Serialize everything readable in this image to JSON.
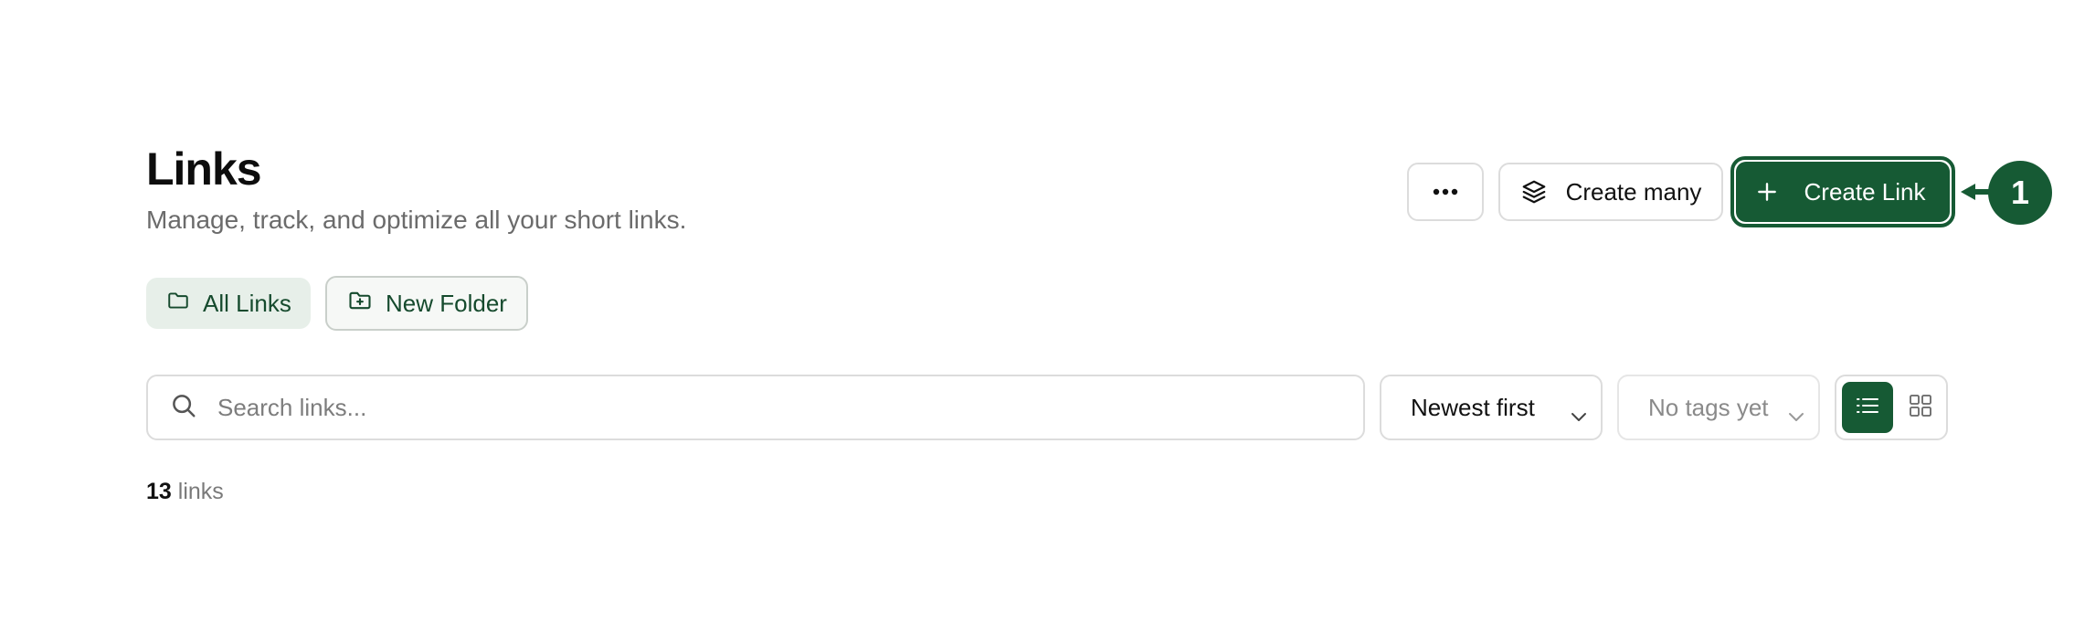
{
  "header": {
    "title": "Links",
    "subtitle": "Manage, track, and optimize all your short links."
  },
  "toolbar": {
    "more_icon": "ellipsis-icon",
    "create_many_label": "Create many",
    "create_many_icon": "layers-icon",
    "create_link_label": "Create Link",
    "create_link_icon": "plus-icon"
  },
  "callout": {
    "number": "1",
    "icon": "arrow-left-icon"
  },
  "folders": {
    "all_links_label": "All Links",
    "all_links_icon": "folder-icon",
    "new_folder_label": "New Folder",
    "new_folder_icon": "folder-plus-icon"
  },
  "search": {
    "placeholder": "Search links...",
    "value": "",
    "icon": "search-icon"
  },
  "filters": {
    "sort_value": "Newest first",
    "tags_value": "No tags yet"
  },
  "view": {
    "active": "list",
    "list_icon": "list-icon",
    "grid_icon": "grid-icon"
  },
  "summary": {
    "count": "13",
    "unit": "links"
  },
  "colors": {
    "accent": "#165a34",
    "chip_bg": "#e7efe9",
    "border": "#dcdcdc",
    "muted_text": "#6b6b6b"
  }
}
